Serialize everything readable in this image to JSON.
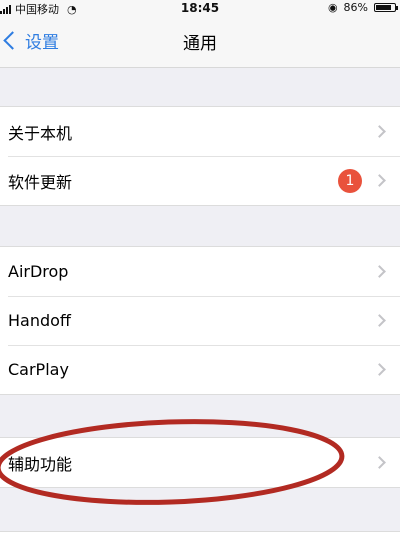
{
  "status_bar": {
    "carrier": "中国移动",
    "time": "18:45",
    "battery": "86%",
    "battery_level": 0.86
  },
  "nav": {
    "back_label": "设置",
    "title": "通用"
  },
  "groups": [
    {
      "items": [
        {
          "label": "关于本机"
        },
        {
          "label": "软件更新",
          "badge": "1"
        }
      ]
    },
    {
      "items": [
        {
          "label": "AirDrop"
        },
        {
          "label": "Handoff"
        },
        {
          "label": "CarPlay"
        }
      ]
    },
    {
      "items": [
        {
          "label": "辅助功能",
          "highlighted": true
        }
      ]
    }
  ],
  "annotation": {
    "color": "#b22a22",
    "shape": "ellipse"
  },
  "colors": {
    "accent": "#2f7de1",
    "badge": "#e9523c",
    "background": "#efeff4"
  },
  "icons": [
    "wifi-icon",
    "alarm-icon",
    "battery-icon",
    "chevron-left-icon",
    "chevron-right-icon"
  ]
}
